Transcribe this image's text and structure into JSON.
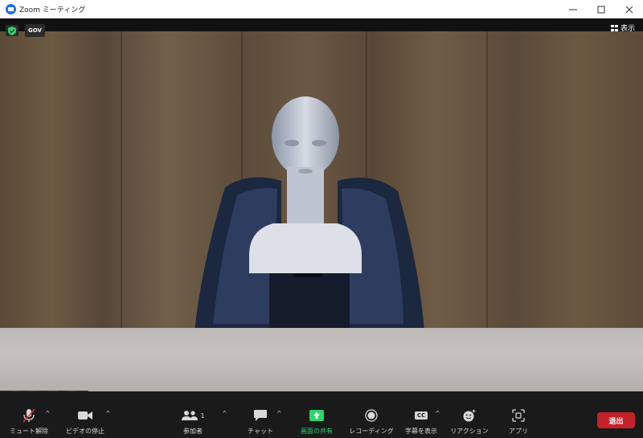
{
  "window": {
    "title": "Zoom ミーティング"
  },
  "video": {
    "security_badge": "GOV",
    "view_label": "表示"
  },
  "toolbar": {
    "mute_label": "ミュート解除",
    "video_label": "ビデオの停止",
    "participants_label": "参加者",
    "participants_count": "1",
    "chat_label": "チャット",
    "share_label": "画面の共有",
    "record_label": "レコーディング",
    "captions_label": "字幕を表示",
    "captions_icon_text": "CC",
    "reactions_label": "リアクション",
    "apps_label": "アプリ",
    "exit_label": "退出"
  },
  "colors": {
    "exit_button": "#c5212a",
    "share_green": "#2dd36f",
    "zoom_blue": "#1d6ef0"
  }
}
